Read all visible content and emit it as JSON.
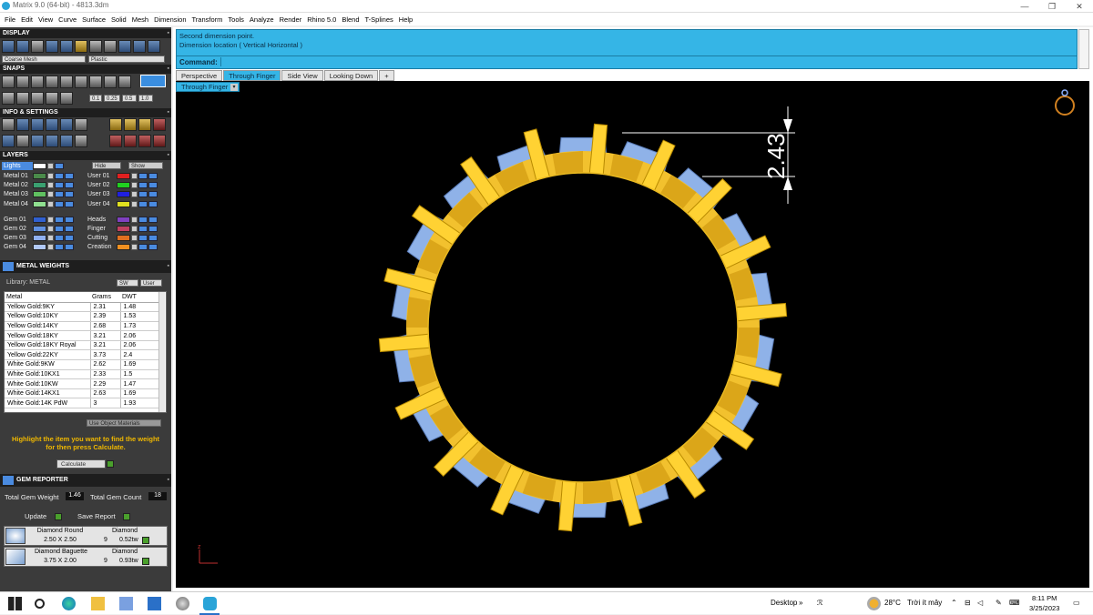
{
  "window": {
    "title": "Matrix 9.0 (64-bit) - 4813.3dm",
    "minimize": "—",
    "maximize": "❐",
    "close": "✕"
  },
  "menu": [
    "File",
    "Edit",
    "View",
    "Curve",
    "Surface",
    "Solid",
    "Mesh",
    "Dimension",
    "Transform",
    "Tools",
    "Analyze",
    "Render",
    "Rhino 5.0",
    "Blend",
    "T-Splines",
    "Help"
  ],
  "panels": {
    "display": {
      "title": "DISPLAY",
      "mesh_select": "Coarse Mesh",
      "material_select": "Plastic"
    },
    "snaps": {
      "title": "SNAPS",
      "values": [
        "0.1",
        "0.25",
        "0.5",
        "1.0"
      ]
    },
    "info": {
      "title": "INFO & SETTINGS"
    },
    "layers": {
      "title": "LAYERS",
      "lights_label": "Lights",
      "hide_label": "Hide",
      "show_label": "Show",
      "left": [
        {
          "name": "Metal 01",
          "color": "#4a8a4a"
        },
        {
          "name": "Metal 02",
          "color": "#3aa070"
        },
        {
          "name": "Metal 03",
          "color": "#60c060"
        },
        {
          "name": "Metal 04",
          "color": "#90e090"
        },
        {
          "name": "Gem 01",
          "color": "#3060d0"
        },
        {
          "name": "Gem 02",
          "color": "#6090e0"
        },
        {
          "name": "Gem 03",
          "color": "#90b0f0"
        },
        {
          "name": "Gem 04",
          "color": "#b0c8f8"
        }
      ],
      "right": [
        {
          "name": "User 01",
          "color": "#e02020"
        },
        {
          "name": "User 02",
          "color": "#20d020"
        },
        {
          "name": "User 03",
          "color": "#2020e0"
        },
        {
          "name": "User 04",
          "color": "#e0e020"
        },
        {
          "name": "Heads",
          "color": "#8040c0"
        },
        {
          "name": "Finger",
          "color": "#c04060"
        },
        {
          "name": "Cutting",
          "color": "#e07020"
        },
        {
          "name": "Creation",
          "color": "#f09020"
        }
      ]
    },
    "metal_weights": {
      "title": "METAL WEIGHTS",
      "library_label": "Library: METAL",
      "sw_label": "SW",
      "user_label": "User",
      "columns": [
        "Metal",
        "Grams",
        "DWT"
      ],
      "rows": [
        [
          "Yellow Gold:9KY",
          "2.31",
          "1.48"
        ],
        [
          "Yellow Gold:10KY",
          "2.39",
          "1.53"
        ],
        [
          "Yellow Gold:14KY",
          "2.68",
          "1.73"
        ],
        [
          "Yellow Gold:18KY",
          "3.21",
          "2.06"
        ],
        [
          "Yellow Gold:18KY Royal",
          "3.21",
          "2.06"
        ],
        [
          "Yellow Gold:22KY",
          "3.73",
          "2.4"
        ],
        [
          "White Gold:9KW",
          "2.62",
          "1.69"
        ],
        [
          "White Gold:10KX1",
          "2.33",
          "1.5"
        ],
        [
          "White Gold:10KW",
          "2.29",
          "1.47"
        ],
        [
          "White Gold:14KX1",
          "2.63",
          "1.69"
        ],
        [
          "White Gold:14K PdW",
          "3",
          "1.93"
        ]
      ],
      "use_object_materials": "Use Object Materials",
      "hint": "Highlight the item you want to find the weight for then press Calculate.",
      "calculate": "Calculate"
    },
    "gem_reporter": {
      "title": "GEM REPORTER",
      "total_weight_label": "Total Gem Weight",
      "total_weight": "1.46",
      "total_count_label": "Total Gem Count",
      "total_count": "18",
      "update": "Update",
      "save_report": "Save Report",
      "gems": [
        {
          "name": "Diamond Round",
          "size": "2.50 X 2.50",
          "material": "Diamond",
          "count": "9",
          "weight": "0.52tw"
        },
        {
          "name": "Diamond Baguette",
          "size": "3.75 X 2.00",
          "material": "Diamond",
          "count": "9",
          "weight": "0.93tw"
        }
      ]
    }
  },
  "command": {
    "line1": "Second dimension point.",
    "line2": "Dimension location ( Vertical  Horizontal )",
    "label": "Command:",
    "value": ""
  },
  "tabs": [
    {
      "label": "Perspective",
      "active": false
    },
    {
      "label": "Through Finger",
      "active": true
    },
    {
      "label": "Side View",
      "active": false
    },
    {
      "label": "Looking Down",
      "active": false
    },
    {
      "label": "+",
      "active": false
    }
  ],
  "viewport": {
    "label": "Through Finger",
    "dimension_value": "2.43",
    "axis_label": "z",
    "gold_color": "#f2c12e",
    "blue_color": "#8fb2e8"
  },
  "taskbar": {
    "desktop": "Desktop",
    "temperature": "28°C",
    "weather": "Trời ít mây",
    "time": "8:11 PM",
    "date": "3/25/2023",
    "lang": "ENG"
  }
}
